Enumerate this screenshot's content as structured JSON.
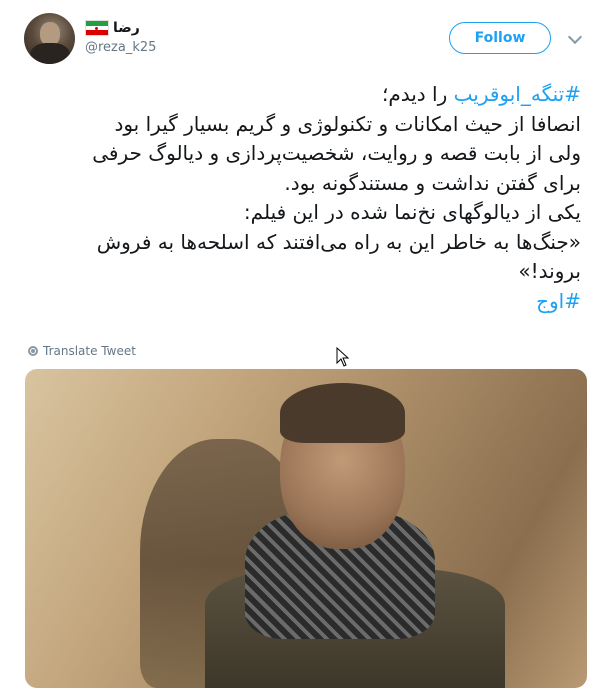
{
  "header": {
    "display_name": "رضا",
    "handle": "@reza_k25",
    "follow_label": "Follow"
  },
  "tweet": {
    "hashtag1": "#تنگه_ابوقریب",
    "line1_rest": " را دیدم؛",
    "lines": [
      "انصافا از حیث امکانات و تکنولوژی و گریم بسیار گیرا بود",
      "ولی از بابت قصه و روایت، شخصیت‌پردازی و دیالوگ حرفی",
      "برای گفتن نداشت و مستندگونه بود.",
      "یکی از دیالوگهای نخ‌نما شده در این فیلم:",
      "«جنگ‌ها به خاطر این به راه می‌افتند که اسلحه‌ها به فروش",
      "بروند!»"
    ],
    "hashtag2": "#اوج"
  },
  "translate_label": "Translate Tweet",
  "colors": {
    "accent": "#1da1f2",
    "text": "#14171a",
    "muted": "#657786"
  }
}
